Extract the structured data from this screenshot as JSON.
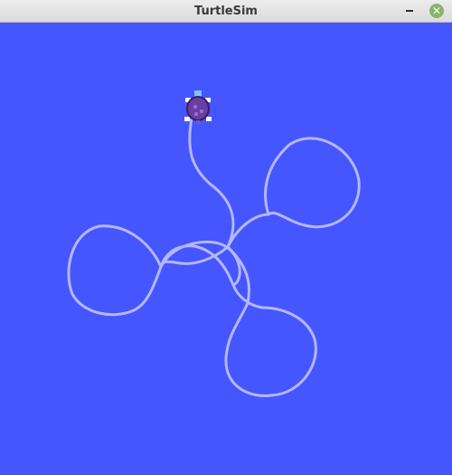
{
  "window": {
    "title": "TurtleSim",
    "close_glyph": "✕"
  },
  "canvas": {
    "background": "#4556ff",
    "pen_color": "#b3b8ff"
  },
  "turtle": {
    "icon": "turtle-icon"
  }
}
